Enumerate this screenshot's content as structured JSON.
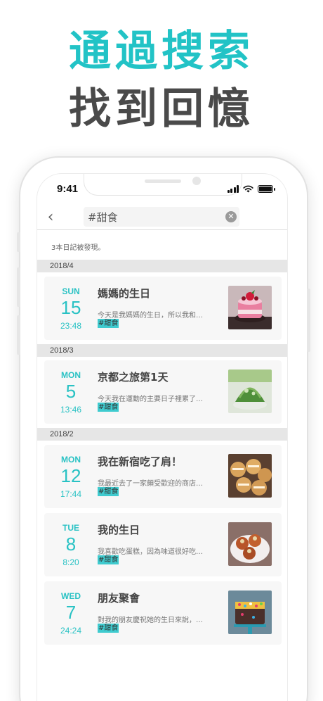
{
  "promo": {
    "line1": "通過搜索",
    "line2": "找到回憶"
  },
  "status_bar": {
    "time": "9:41"
  },
  "search": {
    "back_icon": "‹",
    "query": "#甜食",
    "clear_icon": "✕"
  },
  "results": {
    "count_text": "3本日記被發現。"
  },
  "months": [
    "2018/4",
    "2018/3",
    "2018/2"
  ],
  "entries": [
    {
      "dow": "SUN",
      "day": "15",
      "time": "23:48",
      "title": "媽媽的生日",
      "excerpt": "今天是我媽媽的生日，所以我和…",
      "tag": "#甜食",
      "thumb": "cake"
    },
    {
      "dow": "MON",
      "day": "5",
      "time": "13:46",
      "title": "京都之旅第1天",
      "excerpt": "今天我在運動的主要日子裡累了…",
      "tag": "#甜食",
      "thumb": "shaved-ice"
    },
    {
      "dow": "MON",
      "day": "12",
      "time": "17:44",
      "title": "我在新宿吃了肩！",
      "excerpt": "我最近去了一家頗受歡迎的商店…",
      "tag": "#甜食",
      "thumb": "cream-puffs"
    },
    {
      "dow": "TUE",
      "day": "8",
      "time": "8:20",
      "title": "我的生日",
      "excerpt": "我喜歡吃蛋糕，因為味道很好吃…",
      "tag": "#甜食",
      "thumb": "pastries"
    },
    {
      "dow": "WED",
      "day": "7",
      "time": "24:24",
      "title": "朋友聚會",
      "excerpt": "對我的朋友慶祝她的生日來說，…",
      "tag": "#甜食",
      "thumb": "sprinkle-cake"
    }
  ],
  "colors": {
    "accent": "#22c3c6",
    "headline_dark": "#4a4a4a"
  }
}
